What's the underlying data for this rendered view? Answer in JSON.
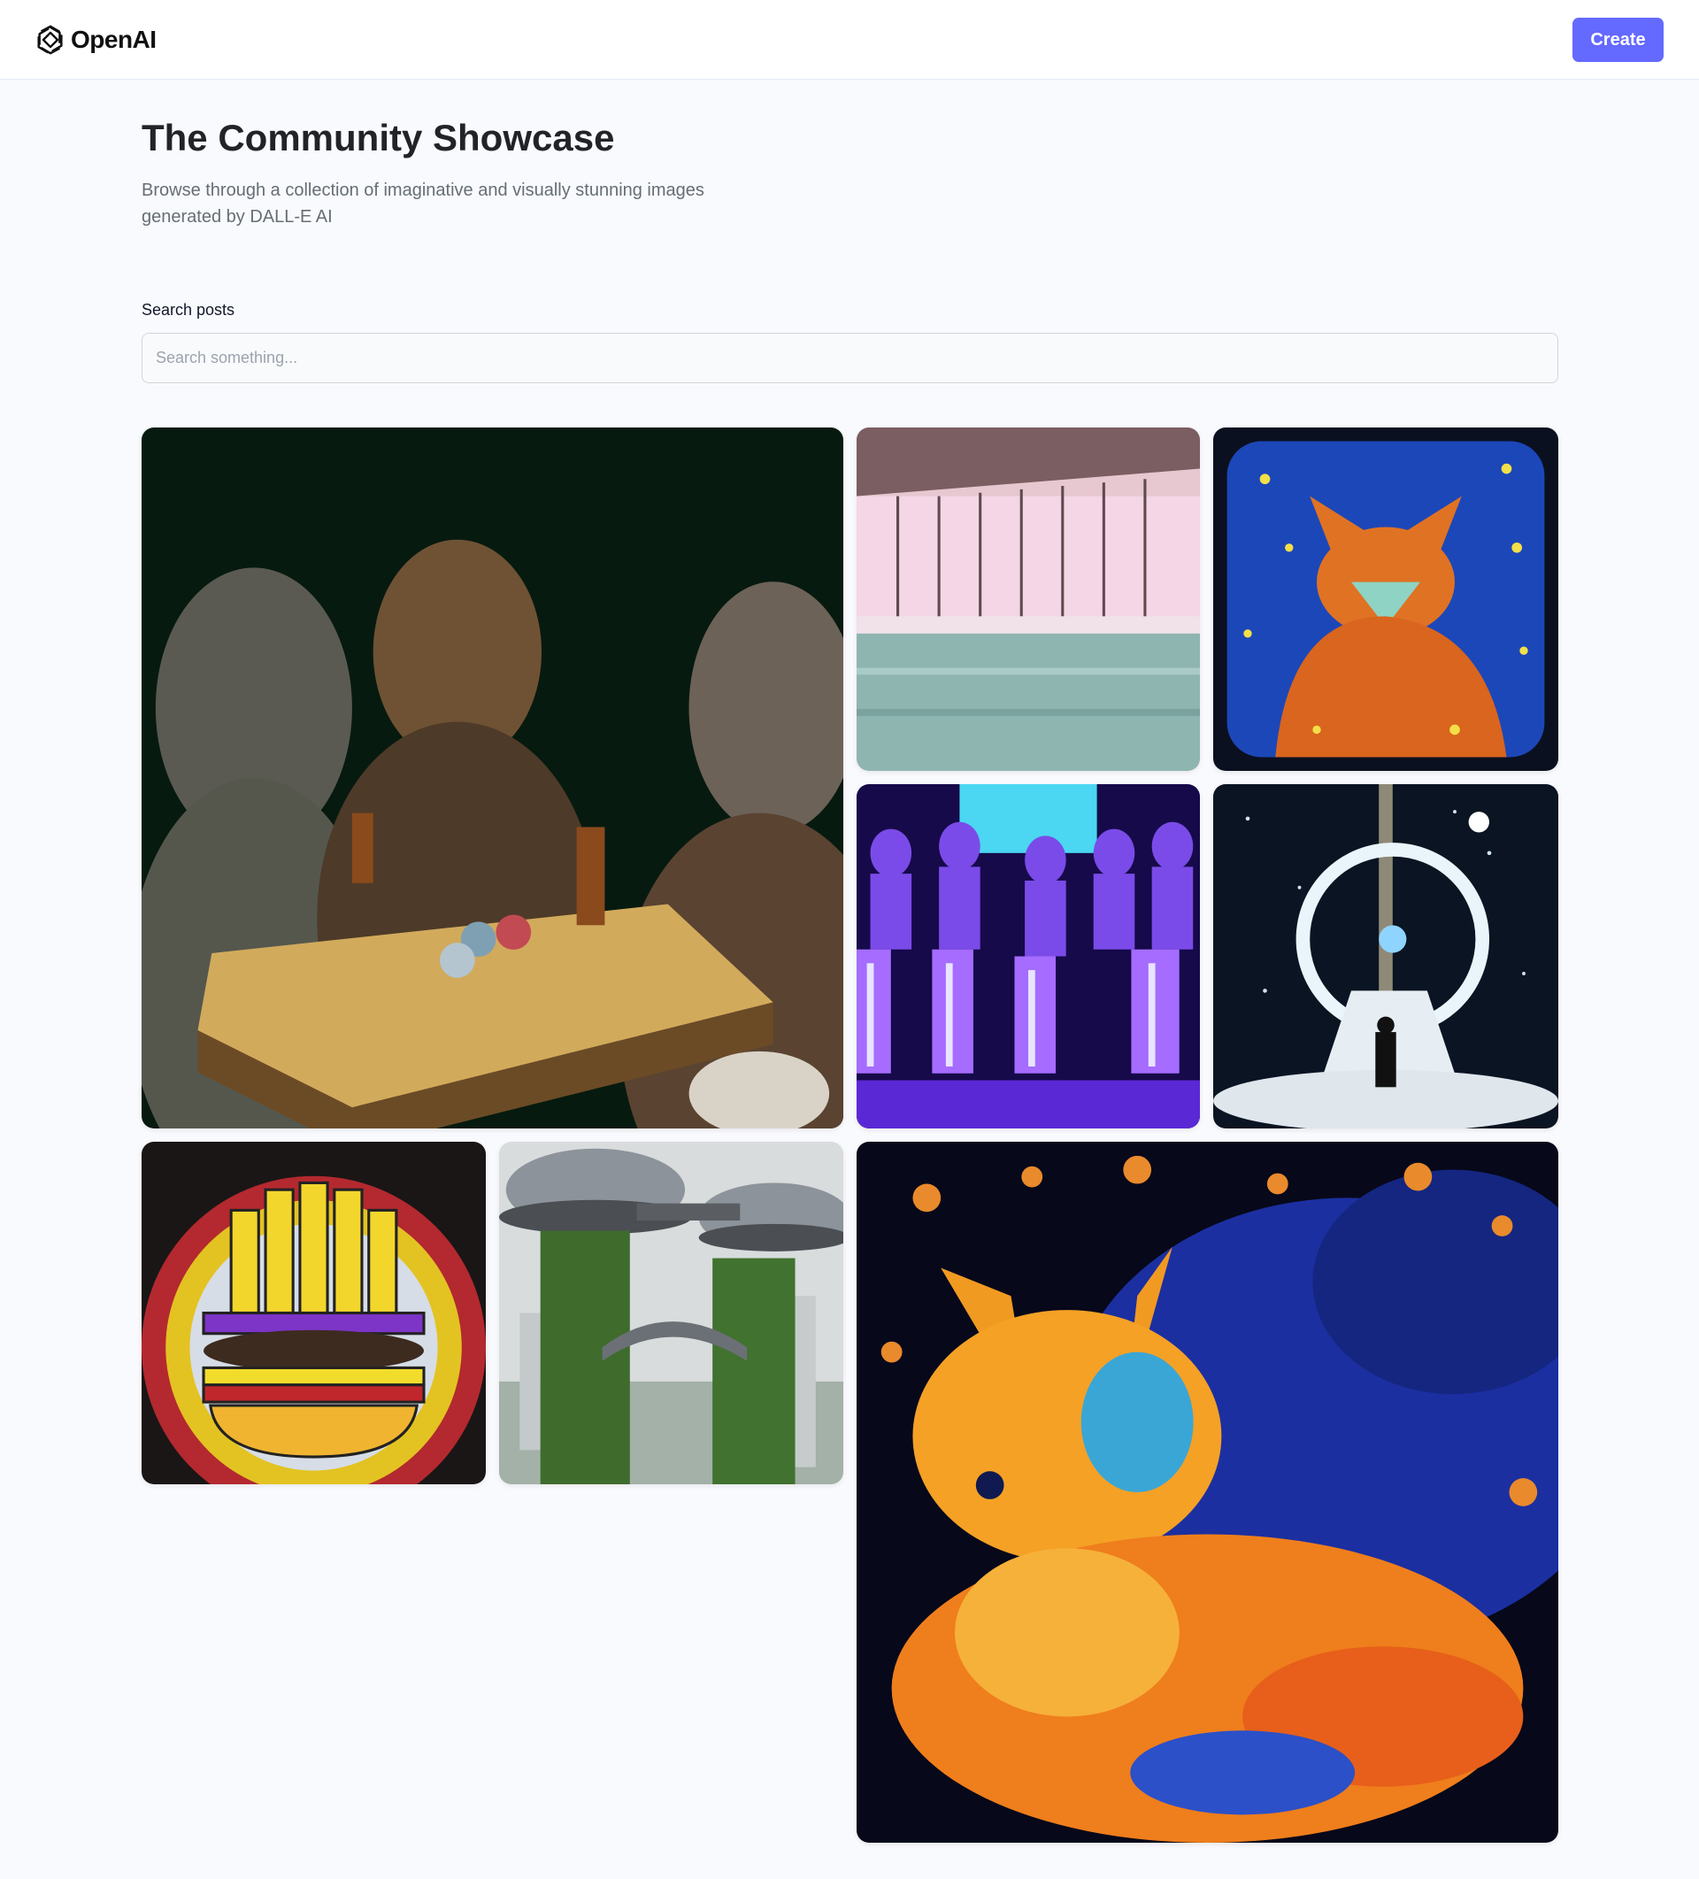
{
  "header": {
    "logo_text": "OpenAI",
    "create_label": "Create"
  },
  "hero": {
    "title": "The Community Showcase",
    "subtitle": "Browse through a collection of imaginative and visually stunning images generated by DALL-E AI"
  },
  "search": {
    "label": "Search posts",
    "placeholder": "Search something...",
    "value": ""
  },
  "colors": {
    "accent": "#6469ff",
    "background": "#f9fafe",
    "title": "#222328",
    "subtitle": "#666e75"
  },
  "gallery": {
    "items": [
      "wolves-poker-image",
      "pink-pool-room-image",
      "starry-fox-painting-image",
      "neon-statues-image",
      "cosmic-portal-man-image",
      "stained-glass-burger-image",
      "futuristic-tree-towers-image",
      "colorful-fox-mosaic-image"
    ]
  }
}
